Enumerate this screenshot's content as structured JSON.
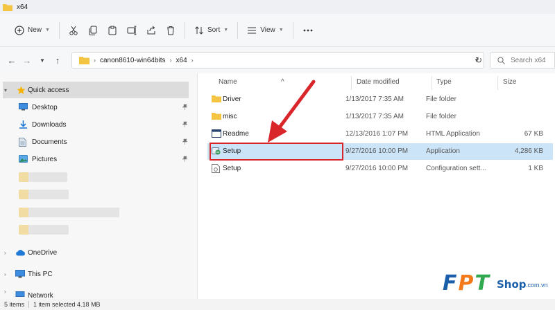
{
  "window": {
    "title": "x64"
  },
  "toolbar": {
    "new_label": "New",
    "sort_label": "Sort",
    "view_label": "View"
  },
  "address": {
    "crumbs": [
      "canon8610-win64bits",
      "x64"
    ],
    "search_placeholder": "Search x64"
  },
  "nav": {
    "quick_access": "Quick access",
    "items": [
      {
        "label": "Desktop",
        "icon": "desktop-icon"
      },
      {
        "label": "Downloads",
        "icon": "download-icon"
      },
      {
        "label": "Documents",
        "icon": "document-icon"
      },
      {
        "label": "Pictures",
        "icon": "pictures-icon"
      }
    ],
    "onedrive": "OneDrive",
    "this_pc": "This PC",
    "network": "Network"
  },
  "columns": {
    "name": "Name",
    "date": "Date modified",
    "type": "Type",
    "size": "Size"
  },
  "files": [
    {
      "name": "Driver",
      "date": "1/13/2017 7:35 AM",
      "type": "File folder",
      "size": "",
      "icon": "folder-icon"
    },
    {
      "name": "misc",
      "date": "1/13/2017 7:35 AM",
      "type": "File folder",
      "size": "",
      "icon": "folder-icon"
    },
    {
      "name": "Readme",
      "date": "12/13/2016 1:07 PM",
      "type": "HTML Application",
      "size": "67 KB",
      "icon": "html-app-icon"
    },
    {
      "name": "Setup",
      "date": "9/27/2016 10:00 PM",
      "type": "Application",
      "size": "4,286 KB",
      "icon": "setup-app-icon",
      "selected": true
    },
    {
      "name": "Setup",
      "date": "9/27/2016 10:00 PM",
      "type": "Configuration sett...",
      "size": "1 KB",
      "icon": "config-file-icon"
    }
  ],
  "status": {
    "items": "5 items",
    "selected": "1 item selected  4.18 MB"
  },
  "watermark": {
    "brand": "FPT",
    "shop": "Shop",
    "domain": ".com.vn"
  },
  "colors": {
    "accent_selection": "#cce4f7",
    "highlight_box": "#d9262b",
    "arrow": "#d9262b",
    "folder": "#f4c542"
  }
}
